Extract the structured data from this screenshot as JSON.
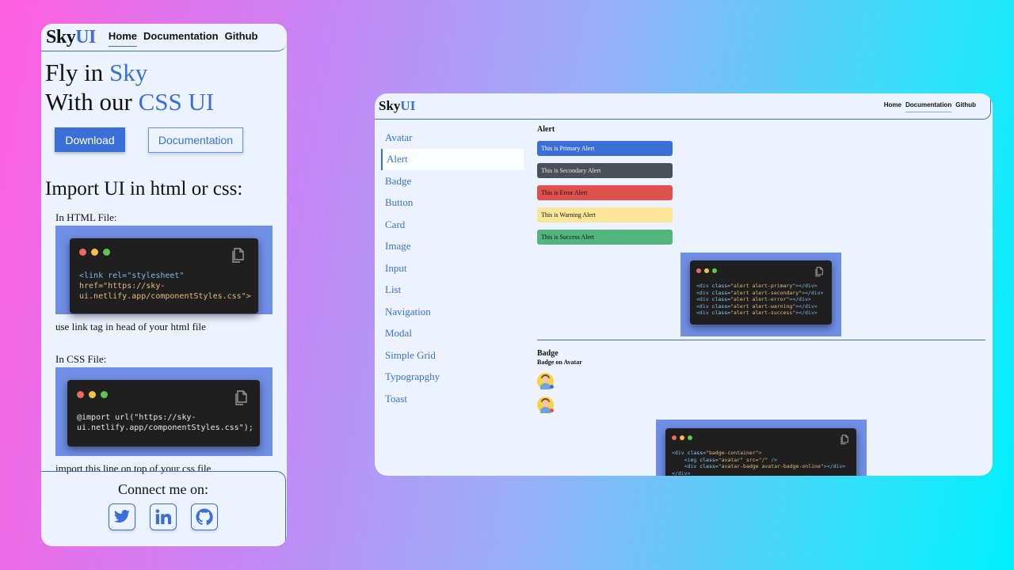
{
  "phone": {
    "brand": {
      "part1": "Sky",
      "part2": "UI"
    },
    "nav": [
      "Home",
      "Documentation",
      "Github"
    ],
    "hero": {
      "line1_a": "Fly in ",
      "line1_b": "Sky",
      "line2_a": "With our ",
      "line2_b": "CSS UI"
    },
    "buttons": {
      "download": "Download",
      "documentation": "Documentation"
    },
    "import_title": "Import UI in html or css:",
    "html_section": {
      "label": "In HTML File:",
      "code": [
        "<link rel=\"stylesheet\"",
        "href=\"https://sky-",
        "ui.netlify.app/componentStyles.css\">"
      ],
      "note": "use link tag in head of your html file"
    },
    "css_section": {
      "label": "In CSS File:",
      "code": [
        "@import url(\"https://sky-",
        "ui.netlify.app/componentStyles.css\");"
      ],
      "note": "import this line on top of your css file"
    },
    "footer": {
      "connect": "Connect me on:",
      "icons": [
        "twitter-icon",
        "linkedin-icon",
        "github-icon"
      ]
    }
  },
  "desktop": {
    "brand": {
      "part1": "Sky",
      "part2": "UI"
    },
    "nav": [
      "Home",
      "Documentation",
      "Github"
    ],
    "sidebar": [
      "Avatar",
      "Alert",
      "Badge",
      "Button",
      "Card",
      "Image",
      "Input",
      "List",
      "Navigation",
      "Modal",
      "Simple Grid",
      "Typograpghy",
      "Toast"
    ],
    "selected_sidebar": "Alert",
    "alert_section": {
      "title": "Alert",
      "alerts": [
        {
          "text": "This is Primary Alert",
          "bg": "#3a6fd8",
          "fg": "#ffffff"
        },
        {
          "text": "This is Secondary Alert",
          "bg": "#4a4f5a",
          "fg": "#e8e8e8"
        },
        {
          "text": "This is Error Alert",
          "bg": "#e0514e",
          "fg": "#111111"
        },
        {
          "text": "This is Warning Alert",
          "bg": "#fde59a",
          "fg": "#111111"
        },
        {
          "text": "This is Success Alert",
          "bg": "#53b57e",
          "fg": "#111111"
        }
      ],
      "code": [
        {
          "tag": "<div ",
          "attr": "class=",
          "val": "\"alert alert-primary\"",
          "end": "></div>"
        },
        {
          "tag": "<div ",
          "attr": "class=",
          "val": "\"alert alert-secondary\"",
          "end": "></div>"
        },
        {
          "tag": "<div ",
          "attr": "class=",
          "val": "\"alert alert-error\"",
          "end": "></div>"
        },
        {
          "tag": "<div ",
          "attr": "class=",
          "val": "\"alert alert-warning\"",
          "end": "></div>"
        },
        {
          "tag": "<div ",
          "attr": "class=",
          "val": "\"alert alert-success\"",
          "end": "></div>"
        }
      ]
    },
    "badge_section": {
      "title": "Badge",
      "subtitle": "Badge on Avatar",
      "badge_colors": [
        "#3a6fd8",
        "#e0514e"
      ],
      "code": [
        {
          "tag": "<div ",
          "attr": "class=",
          "val": "\"badge-container\"",
          "end": ">"
        },
        {
          "tag": "    <img ",
          "attr": "class=",
          "val": "\"avatar\" src=\"/\"",
          "end": " />"
        },
        {
          "tag": "    <div ",
          "attr": "class=",
          "val": "\"avatar-badge avatar-badge-online\"",
          "end": "></div>"
        },
        {
          "tag": "</div>",
          "attr": "",
          "val": "",
          "end": ""
        }
      ]
    }
  }
}
